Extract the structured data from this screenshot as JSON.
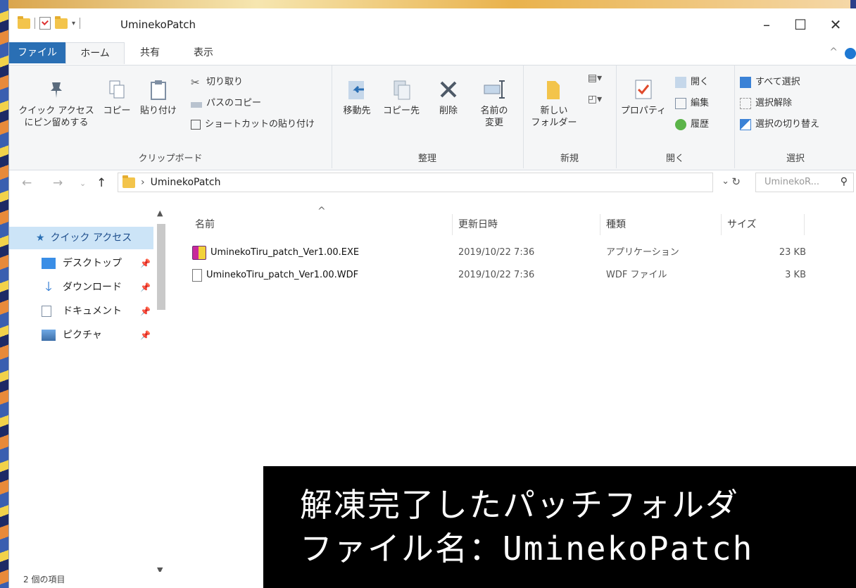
{
  "window": {
    "title": "UminekoPatch",
    "controls": {
      "minimize": "–",
      "maximize": "☐",
      "close": "✕"
    }
  },
  "ribbon_tabs": [
    {
      "label": "ファイル",
      "active": false
    },
    {
      "label": "ホーム",
      "active": true
    },
    {
      "label": "共有",
      "active": false
    },
    {
      "label": "表示",
      "active": false
    }
  ],
  "ribbon": {
    "clipboard": {
      "pin_label_1": "クイック アクセス",
      "pin_label_2": "にピン留めする",
      "copy": "コピー",
      "paste": "貼り付け",
      "cut": "切り取り",
      "copy_path": "パスのコピー",
      "paste_shortcut": "ショートカットの貼り付け",
      "group_label": "クリップボード"
    },
    "organize": {
      "move_to": "移動先",
      "copy_to": "コピー先",
      "delete": "削除",
      "rename_1": "名前の",
      "rename_2": "変更",
      "group_label": "整理"
    },
    "new": {
      "new_folder_1": "新しい",
      "new_folder_2": "フォルダー",
      "group_label": "新規"
    },
    "open": {
      "properties": "プロパティ",
      "open": "開く",
      "edit": "編集",
      "history": "履歴",
      "group_label": "開く"
    },
    "select": {
      "select_all": "すべて選択",
      "select_none": "選択解除",
      "invert": "選択の切り替え",
      "group_label": "選択"
    }
  },
  "address": {
    "path": "UminekoPatch",
    "search_placeholder": "UminekoR..."
  },
  "nav_pane": {
    "quick_access": "クイック アクセス",
    "items": [
      {
        "label": "デスクトップ",
        "icon": "desktop-icon"
      },
      {
        "label": "ダウンロード",
        "icon": "download-icon"
      },
      {
        "label": "ドキュメント",
        "icon": "documents-icon"
      },
      {
        "label": "ピクチャ",
        "icon": "pictures-icon"
      }
    ]
  },
  "file_list": {
    "columns": {
      "name": "名前",
      "date": "更新日時",
      "type": "種類",
      "size": "サイズ"
    },
    "rows": [
      {
        "name": "UminekoTiru_patch_Ver1.00.EXE",
        "date": "2019/10/22 7:36",
        "type": "アプリケーション",
        "size": "23 KB",
        "icon": "exe-icon"
      },
      {
        "name": "UminekoTiru_patch_Ver1.00.WDF",
        "date": "2019/10/22 7:36",
        "type": "WDF ファイル",
        "size": "3 KB",
        "icon": "file-icon"
      }
    ]
  },
  "status_bar": {
    "count": "2 個の項目"
  },
  "caption": {
    "line1": "解凍完了したパッチフォルダ",
    "line2": "ファイル名：UminekoPatch"
  },
  "colors": {
    "accent": "#2a6fb4",
    "selection": "#cce4f7",
    "caption_bg": "#000000"
  }
}
